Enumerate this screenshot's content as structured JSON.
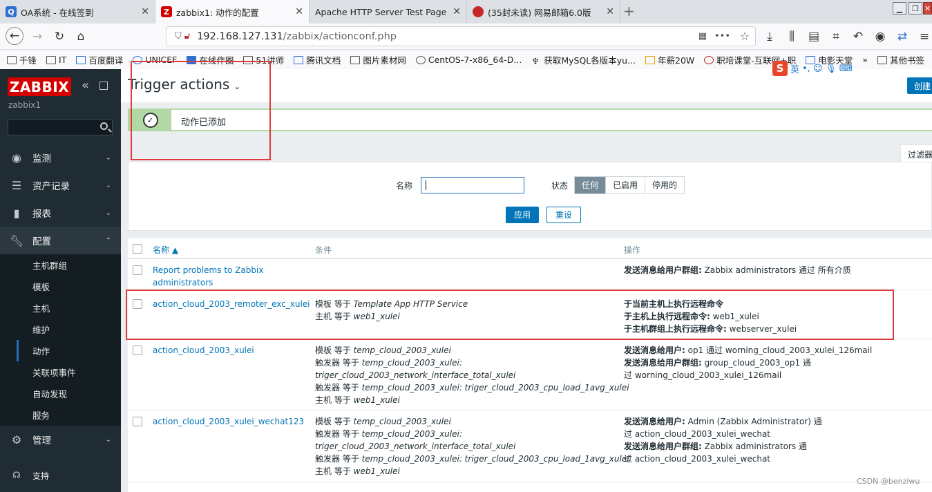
{
  "browser": {
    "tabs": [
      {
        "title": "OA系统 - 在线签到",
        "active": false
      },
      {
        "title": "zabbix1: 动作的配置",
        "active": true
      },
      {
        "title": "Apache HTTP Server Test Page p",
        "active": false
      },
      {
        "title": "(35封未读) 网易邮箱6.0版",
        "active": false
      }
    ],
    "url_host": "192.168.127.131",
    "url_path": "/zabbix/actionconf.php",
    "bookmarks": [
      "千锋",
      "IT",
      "百度翻译",
      "UNICEF",
      "在线作图",
      "51讲师",
      "腾讯文档",
      "图片素材网",
      "CentOS-7-x86_64-D...",
      "获取MySQL各版本yu...",
      "年薪20W",
      "职培课堂-互联网+职",
      "电影天堂",
      "其他书签"
    ]
  },
  "sidebar": {
    "logo": "ZABBIX",
    "server_name": "zabbix1",
    "menu": [
      {
        "label": "监测",
        "icon": "eye-icon"
      },
      {
        "label": "资产记录",
        "icon": "list-icon"
      },
      {
        "label": "报表",
        "icon": "chart-icon"
      },
      {
        "label": "配置",
        "icon": "wrench-icon"
      }
    ],
    "submenu": [
      "主机群组",
      "模板",
      "主机",
      "维护",
      "动作",
      "关联项事件",
      "自动发现",
      "服务"
    ],
    "admin_label": "管理",
    "support_label": "支持"
  },
  "header": {
    "title": "Trigger actions",
    "create_button": "创建"
  },
  "ime": {
    "label": "英"
  },
  "message": {
    "text": "动作已添加"
  },
  "filter": {
    "tab_label": "过滤器",
    "name_label": "名称",
    "name_value": "",
    "status_label": "状态",
    "status_options": [
      "任何",
      "已启用",
      "停用的"
    ],
    "status_selected": "任何",
    "apply": "应用",
    "reset": "重设"
  },
  "table": {
    "headers": {
      "name": "名称 ▲",
      "conditions": "条件",
      "operations": "操作"
    },
    "rows": [
      {
        "name": [
          "Report problems to Zabbix",
          "administrators"
        ],
        "conditions": [],
        "operations": [
          [
            "发送消息给用户群组:",
            " Zabbix administrators 通过 所有介质"
          ]
        ]
      },
      {
        "name": [
          "action_cloud_2003_remoter_exc_xulei"
        ],
        "conditions": [
          [
            "模板 等于 ",
            "Template App HTTP Service"
          ],
          [
            "主机 等于 ",
            "web1_xulei"
          ]
        ],
        "operations": [
          [
            "于当前主机上执行远程命令",
            ""
          ],
          [
            "于主机上执行远程命令:",
            " web1_xulei"
          ],
          [
            "于主机群组上执行远程命令:",
            " webserver_xulei"
          ]
        ]
      },
      {
        "name": [
          "action_cloud_2003_xulei"
        ],
        "conditions": [
          [
            "模板 等于 ",
            "temp_cloud_2003_xulei"
          ],
          [
            "触发器 等于 ",
            "temp_cloud_2003_xulei:"
          ],
          [
            "",
            "triger_cloud_2003_network_interface_total_xulei"
          ],
          [
            "触发器 等于 ",
            "temp_cloud_2003_xulei: triger_cloud_2003_cpu_load_1avg_xulei"
          ],
          [
            "主机 等于 ",
            "web1_xulei"
          ]
        ],
        "operations": [
          [
            "发送消息给用户:",
            " op1 通过 worning_cloud_2003_xulei_126mail"
          ],
          [
            "发送消息给用户群组:",
            " group_cloud_2003_op1 通"
          ],
          [
            "",
            "过 worning_cloud_2003_xulei_126mail"
          ]
        ]
      },
      {
        "name": [
          "action_cloud_2003_xulei_wechat123"
        ],
        "conditions": [
          [
            "模板 等于 ",
            "temp_cloud_2003_xulei"
          ],
          [
            "触发器 等于 ",
            "temp_cloud_2003_xulei:"
          ],
          [
            "",
            "triger_cloud_2003_network_interface_total_xulei"
          ],
          [
            "触发器 等于 ",
            "temp_cloud_2003_xulei: triger_cloud_2003_cpu_load_1avg_xulei"
          ],
          [
            "主机 等于 ",
            "web1_xulei"
          ]
        ],
        "operations": [
          [
            "发送消息给用户:",
            " Admin (Zabbix Administrator) 通"
          ],
          [
            "",
            "过 action_cloud_2003_xulei_wechat"
          ],
          [
            "发送消息给用户群组:",
            " Zabbix administrators 通"
          ],
          [
            "",
            "过 action_cloud_2003_xulei_wechat"
          ]
        ]
      }
    ]
  },
  "watermark": "CSDN @benziwu",
  "colors": {
    "brand": "#d40000",
    "accent": "#0275b8",
    "sidebar": "#1f2c33",
    "success": "#b2d8a5",
    "annotation": "#e03a3a"
  }
}
